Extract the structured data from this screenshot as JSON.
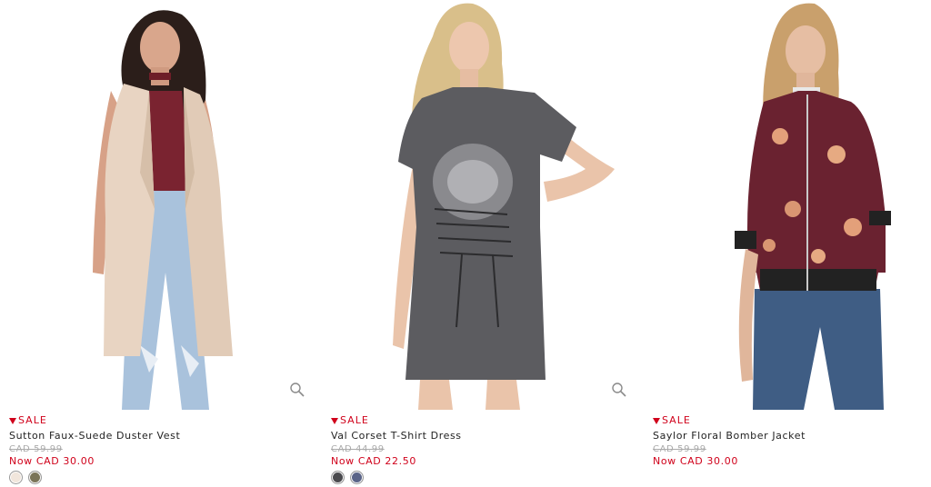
{
  "products": [
    {
      "sale_label": "SALE",
      "name": "Sutton Faux-Suede Duster Vest",
      "original_price": "CAD 59.99",
      "now_price": "Now CAD 30.00",
      "swatch_colors": [
        "#f1e6dc",
        "#7a7458"
      ]
    },
    {
      "sale_label": "SALE",
      "name": "Val Corset T-Shirt Dress",
      "original_price": "CAD 44.99",
      "now_price": "Now CAD 22.50",
      "swatch_colors": [
        "#4a4a4e",
        "#5a6488"
      ]
    },
    {
      "sale_label": "SALE",
      "name": "Saylor Floral Bomber Jacket",
      "original_price": "CAD 59.99",
      "now_price": "Now CAD 30.00",
      "swatch_colors": []
    }
  ],
  "icons": {
    "sale_marker": "triangle-down-icon",
    "zoom": "magnifier-icon"
  },
  "colors": {
    "sale_red": "#d0021b",
    "text": "#222222",
    "strike": "#aaaaaa"
  }
}
